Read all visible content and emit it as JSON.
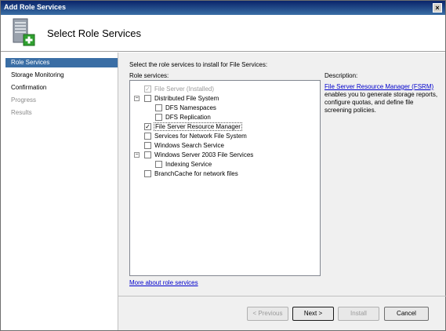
{
  "window": {
    "title": "Add Role Services",
    "close_label": "×"
  },
  "header": {
    "page_title": "Select Role Services"
  },
  "nav": {
    "items": [
      {
        "label": "Role Services",
        "state": "selected"
      },
      {
        "label": "Storage Monitoring",
        "state": "normal"
      },
      {
        "label": "Confirmation",
        "state": "normal"
      },
      {
        "label": "Progress",
        "state": "disabled"
      },
      {
        "label": "Results",
        "state": "disabled"
      }
    ]
  },
  "content": {
    "instruction": "Select the role services to install for File Services:",
    "role_services_label": "Role services:",
    "description_label": "Description:",
    "tree": [
      {
        "label": "File Server  (Installed)",
        "checked": true,
        "disabled": true
      },
      {
        "label": "Distributed File System",
        "checked": false,
        "expander": "−"
      },
      {
        "label": "DFS Namespaces",
        "checked": false
      },
      {
        "label": "DFS Replication",
        "checked": false
      },
      {
        "label": "File Server Resource Manager",
        "checked": true,
        "selected": true
      },
      {
        "label": "Services for Network File System",
        "checked": false
      },
      {
        "label": "Windows Search Service",
        "checked": false
      },
      {
        "label": "Windows Server 2003 File Services",
        "checked": false,
        "expander": "−"
      },
      {
        "label": "Indexing Service",
        "checked": false
      },
      {
        "label": "BranchCache for network files",
        "checked": false
      }
    ],
    "description": {
      "link_text": "File Server Resource Manager (FSRM)",
      "body": "enables you to generate storage reports, configure quotas, and define file screening policies."
    },
    "more_link": "More about role services"
  },
  "buttons": {
    "previous": "< Previous",
    "next": "Next >",
    "install": "Install",
    "cancel": "Cancel"
  },
  "colors": {
    "accent": "#3a6ea5",
    "link": "#0000cc"
  },
  "icons": {
    "header": "server-add-icon",
    "check": "✓"
  }
}
